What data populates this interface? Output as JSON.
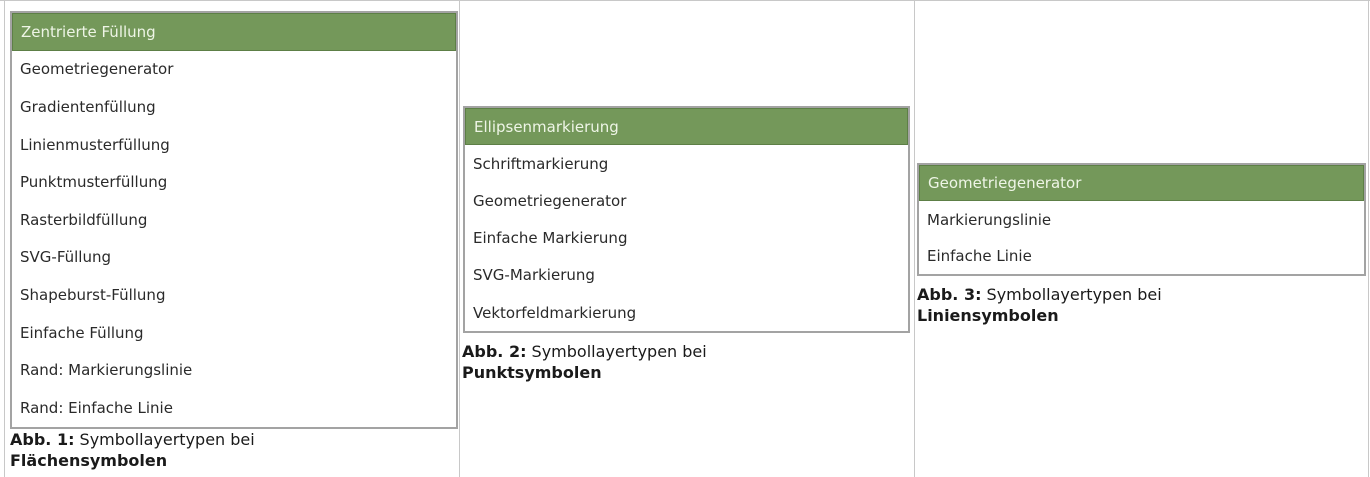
{
  "panels": [
    {
      "items": [
        "Zentrierte Füllung",
        "Geometriegenerator",
        "Gradientenfüllung",
        "Linienmusterfüllung",
        "Punktmusterfüllung",
        "Rasterbildfüllung",
        "SVG-Füllung",
        "Shapeburst-Füllung",
        "Einfache Füllung",
        "Rand: Markierungslinie",
        "Rand: Einfache Linie"
      ],
      "selected_index": 0,
      "caption_prefix": "Abb. 1:",
      "caption_text": " Symbollayertypen bei",
      "caption_bold": "Flächensymbolen"
    },
    {
      "items": [
        "Ellipsenmarkierung",
        "Schriftmarkierung",
        "Geometriegenerator",
        "Einfache Markierung",
        "SVG-Markierung",
        "Vektorfeldmarkierung"
      ],
      "selected_index": 0,
      "caption_prefix": "Abb. 2:",
      "caption_text": " Symbollayertypen bei",
      "caption_bold": "Punktsymbolen"
    },
    {
      "items": [
        "Geometriegenerator",
        "Markierungslinie",
        "Einfache Linie"
      ],
      "selected_index": 0,
      "caption_prefix": "Abb. 3:",
      "caption_text": " Symbollayertypen bei",
      "caption_bold": "Liniensymbolen"
    }
  ],
  "colors": {
    "selected_bg": "#74985a",
    "selected_text": "#eef5e6",
    "list_border": "#a3a3a3",
    "cell_border": "#c8c8c8"
  }
}
